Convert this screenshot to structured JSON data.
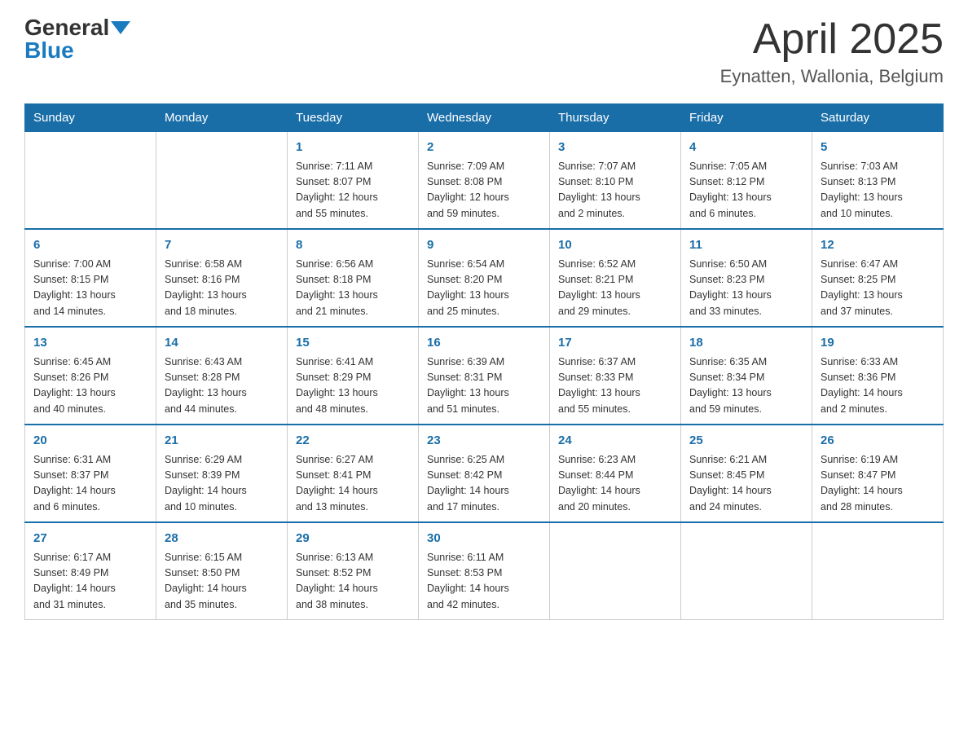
{
  "header": {
    "logo_general": "General",
    "logo_blue": "Blue",
    "title": "April 2025",
    "subtitle": "Eynatten, Wallonia, Belgium"
  },
  "days_of_week": [
    "Sunday",
    "Monday",
    "Tuesday",
    "Wednesday",
    "Thursday",
    "Friday",
    "Saturday"
  ],
  "weeks": [
    [
      {
        "num": "",
        "info": ""
      },
      {
        "num": "",
        "info": ""
      },
      {
        "num": "1",
        "info": "Sunrise: 7:11 AM\nSunset: 8:07 PM\nDaylight: 12 hours\nand 55 minutes."
      },
      {
        "num": "2",
        "info": "Sunrise: 7:09 AM\nSunset: 8:08 PM\nDaylight: 12 hours\nand 59 minutes."
      },
      {
        "num": "3",
        "info": "Sunrise: 7:07 AM\nSunset: 8:10 PM\nDaylight: 13 hours\nand 2 minutes."
      },
      {
        "num": "4",
        "info": "Sunrise: 7:05 AM\nSunset: 8:12 PM\nDaylight: 13 hours\nand 6 minutes."
      },
      {
        "num": "5",
        "info": "Sunrise: 7:03 AM\nSunset: 8:13 PM\nDaylight: 13 hours\nand 10 minutes."
      }
    ],
    [
      {
        "num": "6",
        "info": "Sunrise: 7:00 AM\nSunset: 8:15 PM\nDaylight: 13 hours\nand 14 minutes."
      },
      {
        "num": "7",
        "info": "Sunrise: 6:58 AM\nSunset: 8:16 PM\nDaylight: 13 hours\nand 18 minutes."
      },
      {
        "num": "8",
        "info": "Sunrise: 6:56 AM\nSunset: 8:18 PM\nDaylight: 13 hours\nand 21 minutes."
      },
      {
        "num": "9",
        "info": "Sunrise: 6:54 AM\nSunset: 8:20 PM\nDaylight: 13 hours\nand 25 minutes."
      },
      {
        "num": "10",
        "info": "Sunrise: 6:52 AM\nSunset: 8:21 PM\nDaylight: 13 hours\nand 29 minutes."
      },
      {
        "num": "11",
        "info": "Sunrise: 6:50 AM\nSunset: 8:23 PM\nDaylight: 13 hours\nand 33 minutes."
      },
      {
        "num": "12",
        "info": "Sunrise: 6:47 AM\nSunset: 8:25 PM\nDaylight: 13 hours\nand 37 minutes."
      }
    ],
    [
      {
        "num": "13",
        "info": "Sunrise: 6:45 AM\nSunset: 8:26 PM\nDaylight: 13 hours\nand 40 minutes."
      },
      {
        "num": "14",
        "info": "Sunrise: 6:43 AM\nSunset: 8:28 PM\nDaylight: 13 hours\nand 44 minutes."
      },
      {
        "num": "15",
        "info": "Sunrise: 6:41 AM\nSunset: 8:29 PM\nDaylight: 13 hours\nand 48 minutes."
      },
      {
        "num": "16",
        "info": "Sunrise: 6:39 AM\nSunset: 8:31 PM\nDaylight: 13 hours\nand 51 minutes."
      },
      {
        "num": "17",
        "info": "Sunrise: 6:37 AM\nSunset: 8:33 PM\nDaylight: 13 hours\nand 55 minutes."
      },
      {
        "num": "18",
        "info": "Sunrise: 6:35 AM\nSunset: 8:34 PM\nDaylight: 13 hours\nand 59 minutes."
      },
      {
        "num": "19",
        "info": "Sunrise: 6:33 AM\nSunset: 8:36 PM\nDaylight: 14 hours\nand 2 minutes."
      }
    ],
    [
      {
        "num": "20",
        "info": "Sunrise: 6:31 AM\nSunset: 8:37 PM\nDaylight: 14 hours\nand 6 minutes."
      },
      {
        "num": "21",
        "info": "Sunrise: 6:29 AM\nSunset: 8:39 PM\nDaylight: 14 hours\nand 10 minutes."
      },
      {
        "num": "22",
        "info": "Sunrise: 6:27 AM\nSunset: 8:41 PM\nDaylight: 14 hours\nand 13 minutes."
      },
      {
        "num": "23",
        "info": "Sunrise: 6:25 AM\nSunset: 8:42 PM\nDaylight: 14 hours\nand 17 minutes."
      },
      {
        "num": "24",
        "info": "Sunrise: 6:23 AM\nSunset: 8:44 PM\nDaylight: 14 hours\nand 20 minutes."
      },
      {
        "num": "25",
        "info": "Sunrise: 6:21 AM\nSunset: 8:45 PM\nDaylight: 14 hours\nand 24 minutes."
      },
      {
        "num": "26",
        "info": "Sunrise: 6:19 AM\nSunset: 8:47 PM\nDaylight: 14 hours\nand 28 minutes."
      }
    ],
    [
      {
        "num": "27",
        "info": "Sunrise: 6:17 AM\nSunset: 8:49 PM\nDaylight: 14 hours\nand 31 minutes."
      },
      {
        "num": "28",
        "info": "Sunrise: 6:15 AM\nSunset: 8:50 PM\nDaylight: 14 hours\nand 35 minutes."
      },
      {
        "num": "29",
        "info": "Sunrise: 6:13 AM\nSunset: 8:52 PM\nDaylight: 14 hours\nand 38 minutes."
      },
      {
        "num": "30",
        "info": "Sunrise: 6:11 AM\nSunset: 8:53 PM\nDaylight: 14 hours\nand 42 minutes."
      },
      {
        "num": "",
        "info": ""
      },
      {
        "num": "",
        "info": ""
      },
      {
        "num": "",
        "info": ""
      }
    ]
  ]
}
